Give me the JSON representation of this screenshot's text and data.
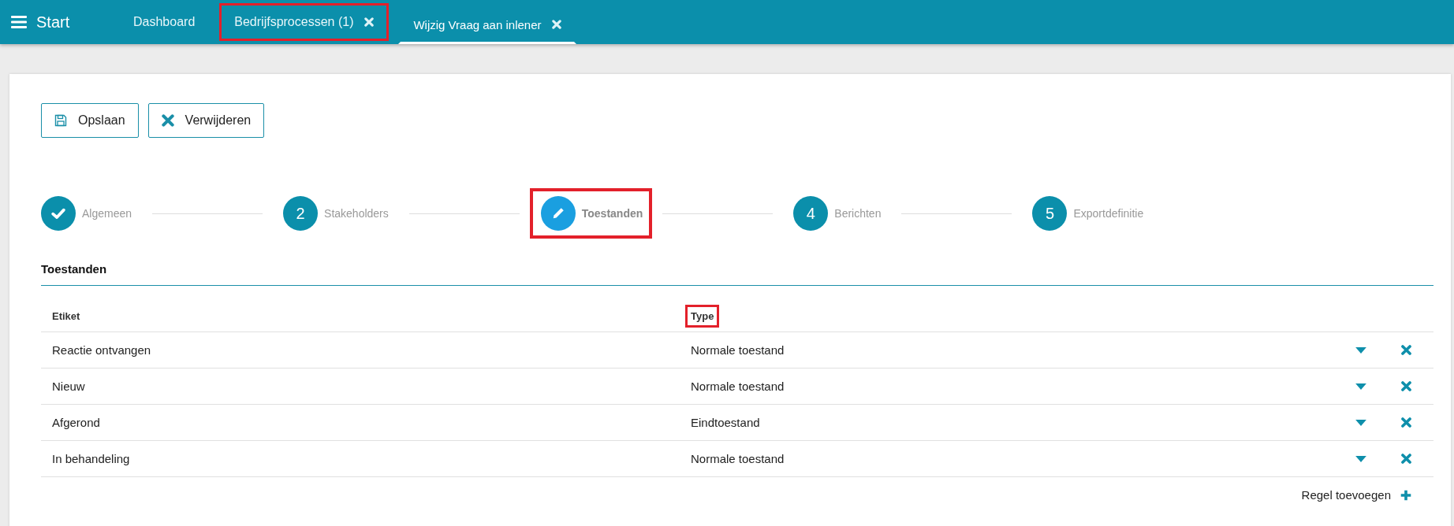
{
  "topbar": {
    "title": "Start"
  },
  "tabs": [
    {
      "label": "Dashboard",
      "closable": false,
      "selected": false,
      "highlighted": false
    },
    {
      "label": "Bedrijfsprocessen (1)",
      "closable": true,
      "selected": false,
      "highlighted": true
    },
    {
      "label": "Wijzig Vraag aan inlener",
      "closable": true,
      "selected": true,
      "highlighted": false
    }
  ],
  "toolbar": [
    {
      "label": "Opslaan",
      "kind": "save"
    },
    {
      "label": "Verwijderen",
      "kind": "delete"
    }
  ],
  "steps": [
    {
      "kind": "done",
      "label": "Algemeen",
      "highlighted": false
    },
    {
      "kind": "number",
      "number": "2",
      "label": "Stakeholders",
      "highlighted": false
    },
    {
      "kind": "current",
      "label": "Toestanden",
      "highlighted": true
    },
    {
      "kind": "number",
      "number": "4",
      "label": "Berichten",
      "highlighted": false
    },
    {
      "kind": "number",
      "number": "5",
      "label": "Exportdefinitie",
      "highlighted": false
    }
  ],
  "section_title": "Toestanden",
  "table": {
    "columns": [
      {
        "label": "Etiket",
        "highlighted": false
      },
      {
        "label": "Type",
        "highlighted": true
      }
    ],
    "rows": [
      [
        "Reactie ontvangen",
        "Normale toestand"
      ],
      [
        "Nieuw",
        "Normale toestand"
      ],
      [
        "Afgerond",
        "Eindtoestand"
      ],
      [
        "In behandeling",
        "Normale toestand"
      ]
    ]
  },
  "add_row": "Regel toevoegen"
}
